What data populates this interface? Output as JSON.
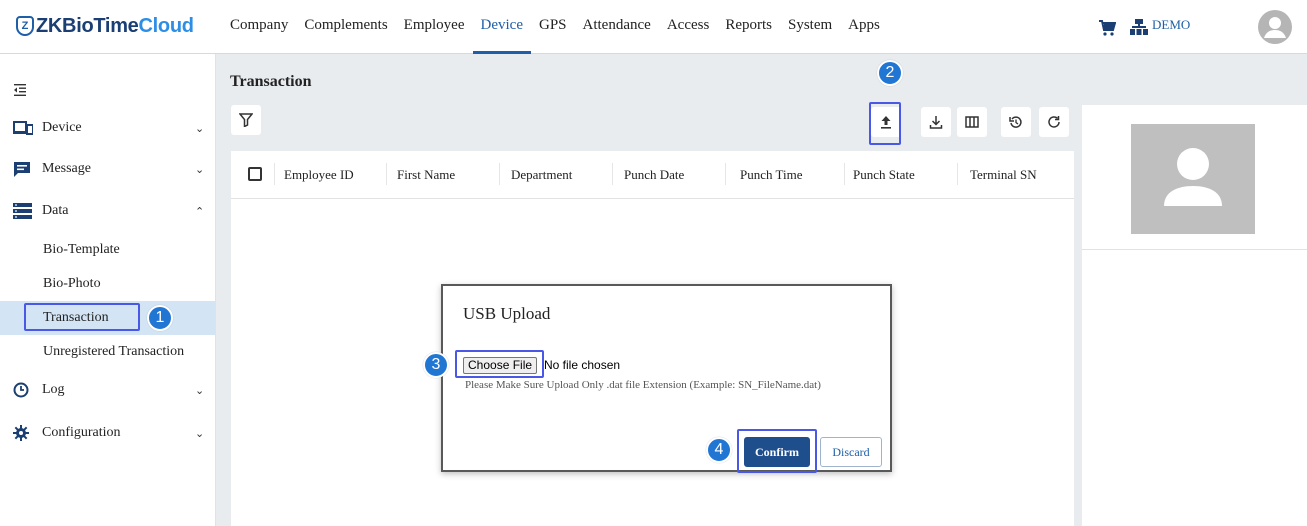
{
  "header": {
    "logo_badge": "Z",
    "logo_main": "ZKBioTime",
    "logo_accent": "Cloud",
    "nav": [
      "Company",
      "Complements",
      "Employee",
      "Device",
      "GPS",
      "Attendance",
      "Access",
      "Reports",
      "System",
      "Apps"
    ],
    "active_nav": "Device",
    "user_label": "DEMO",
    "icons": [
      "cart-icon",
      "organization-icon",
      "user-avatar-icon"
    ]
  },
  "sidebar": {
    "sections": {
      "device": "Device",
      "message": "Message",
      "data": "Data",
      "log": "Log",
      "configuration": "Configuration"
    },
    "data_items": {
      "bio_template": "Bio-Template",
      "bio_photo": "Bio-Photo",
      "transaction": "Transaction",
      "unregistered_transaction": "Unregistered Transaction"
    },
    "chevron_down": "⌄",
    "chevron_up": "⌃"
  },
  "main": {
    "title": "Transaction",
    "toolbar_icons": [
      "filter-icon",
      "upload-icon",
      "download-icon",
      "columns-icon",
      "history-icon",
      "refresh-icon"
    ],
    "columns": [
      "Employee ID",
      "First Name",
      "Department",
      "Punch Date",
      "Punch Time",
      "Punch State",
      "Terminal SN"
    ]
  },
  "dialog": {
    "title": "USB Upload",
    "choose_file_label": "Choose File",
    "file_status": "No file chosen",
    "hint": "Please Make Sure Upload Only .dat file Extension (Example: SN_FileName.dat)",
    "confirm_label": "Confirm",
    "discard_label": "Discard"
  },
  "steps": [
    "1",
    "2",
    "3",
    "4"
  ],
  "colors": {
    "accent": "#1e5fa8",
    "step_badge": "#2176d4",
    "highlight_box": "#4a58e8",
    "active_row": "#d3e5f5",
    "confirm_bg": "#1f4e8c"
  }
}
